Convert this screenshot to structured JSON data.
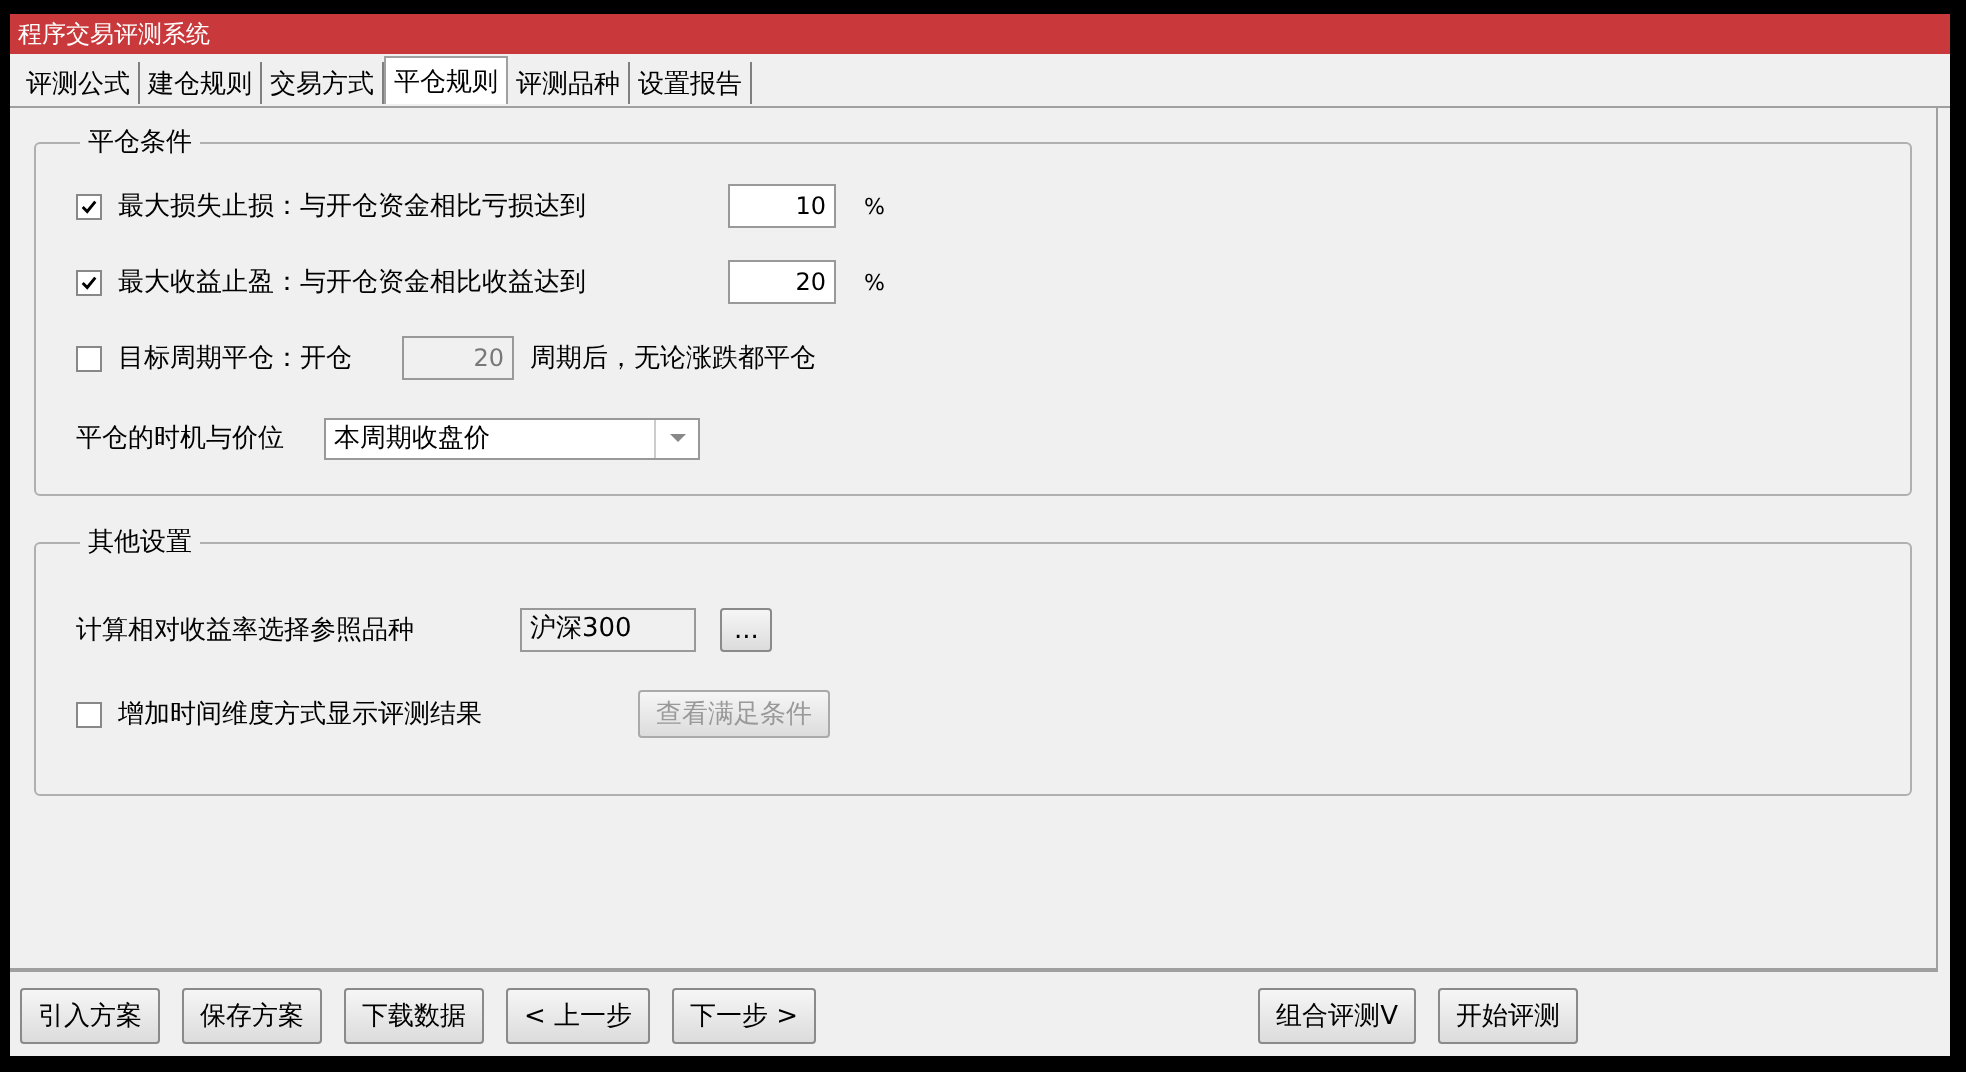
{
  "window": {
    "title": "程序交易评测系统"
  },
  "tabs": [
    {
      "label": "评测公式",
      "selected": false
    },
    {
      "label": "建仓规则",
      "selected": false
    },
    {
      "label": "交易方式",
      "selected": false
    },
    {
      "label": "平仓规则",
      "selected": true
    },
    {
      "label": "评测品种",
      "selected": false
    },
    {
      "label": "设置报告",
      "selected": false
    }
  ],
  "close_conditions": {
    "title": "平仓条件",
    "rows": [
      {
        "kind": "percent",
        "label": "最大损失止损：与开仓资金相比亏损达到",
        "checked": true,
        "value": "10",
        "unit": "%"
      },
      {
        "kind": "percent",
        "label": "最大收益止盈：与开仓资金相比收益达到",
        "checked": true,
        "value": "20",
        "unit": "%"
      },
      {
        "kind": "period",
        "label": "目标周期平仓：开仓",
        "checked": false,
        "value": "20",
        "suffix": "周期后，无论涨跌都平仓"
      }
    ],
    "timing": {
      "label": "平仓的时机与价位",
      "value": "本周期收盘价"
    }
  },
  "other_settings": {
    "title": "其他设置",
    "reference": {
      "label": "计算相对收益率选择参照品种",
      "value": "沪深300",
      "button": "..."
    },
    "time_dimension": {
      "label": "增加时间维度方式显示评测结果",
      "checked": false,
      "button": "查看满足条件",
      "button_disabled": true
    }
  },
  "buttons_left": [
    "引入方案",
    "保存方案",
    "下载数据",
    "< 上一步",
    "下一步 >"
  ],
  "buttons_right": [
    "组合评测V",
    "开始评测"
  ]
}
